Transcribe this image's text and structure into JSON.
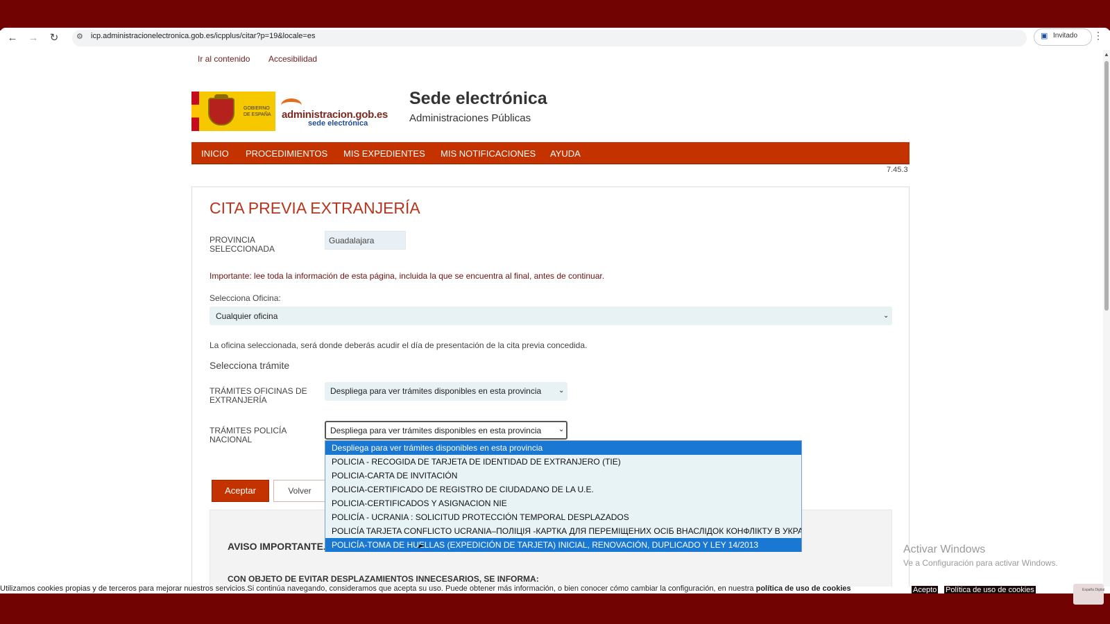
{
  "browser": {
    "url": "icp.administracionelectronica.gob.es/icpplus/citar?p=19&locale=es",
    "profile_label": "Invitado"
  },
  "skip_links": {
    "content": "Ir al contenido",
    "accessibility": "Accesibilidad"
  },
  "header": {
    "gobierno_text": "GOBIERNO\nDE ESPAÑA",
    "logo_text": "administracion.gob.es",
    "logo_subtext": "sede electrónica",
    "title": "Sede electrónica",
    "subtitle": "Administraciones Públicas"
  },
  "nav": {
    "items": [
      "INICIO",
      "PROCEDIMIENTOS",
      "MIS EXPEDIENTES",
      "MIS NOTIFICACIONES",
      "AYUDA"
    ],
    "version": "7.45.3"
  },
  "form": {
    "title": "CITA PREVIA EXTRANJERÍA",
    "province_label_1": "PROVINCIA",
    "province_label_2": "SELECCIONADA",
    "province_value": "Guadalajara",
    "important": "Importante: lee toda la información de esta página, incluida la que se encuentra al final, antes de continuar.",
    "office_label": "Selecciona Oficina:",
    "office_value": "Cualquier oficina",
    "office_note": "La oficina seleccionada, será donde deberás acudir el día de presentación de la cita previa concedida.",
    "tramite_heading": "Selecciona trámite",
    "extranjeria_label_1": "TRÁMITES OFICINAS DE",
    "extranjeria_label_2": "EXTRANJERÍA",
    "extranjeria_value": "Despliega para ver trámites disponibles en esta provincia",
    "policia_label_1": "TRÁMITES POLICÍA",
    "policia_label_2": "NACIONAL",
    "policia_value": "Despliega para ver trámites disponibles en esta provincia",
    "accept_label": "Aceptar",
    "back_label": "Volver"
  },
  "dropdown": {
    "options": [
      "Despliega para ver trámites disponibles en esta provincia",
      "POLICIA - RECOGIDA DE TARJETA DE IDENTIDAD DE EXTRANJERO (TIE)",
      "POLICIA-CARTA DE INVITACIÓN",
      "POLICIA-CERTIFICADO DE REGISTRO DE CIUDADANO DE LA U.E.",
      "POLICIA-CERTIFICADOS Y ASIGNACION NIE",
      "POLICÍA - UCRANIA : SOLICITUD PROTECCIÓN TEMPORAL DESPLAZADOS",
      "POLICÍA TARJETA CONFLICTO UCRANIA–ПОЛІЦІЯ -КАРТКА ДЛЯ ПЕРЕМІЩЕНИХ ОСІБ ВНАСЛІДОК КОНФЛІКТУ В УКРАЇНІ",
      "POLICÍA-TOMA DE HUELLAS (EXPEDICIÓN DE TARJETA) INICIAL, RENOVACIÓN, DUPLICADO Y LEY 14/2013"
    ]
  },
  "notice": {
    "title": "AVISO IMPORTANTE.",
    "text": "CON OBJETO DE EVITAR DESPLAZAMIENTOS INNECESARIOS, SE INFORMA:"
  },
  "windows": {
    "line1": "Activar Windows",
    "line2": "Ve a Configuración para activar Windows."
  },
  "cookies": {
    "text": "Utilizamos cookies propias y de terceros para mejorar nuestros servicios.Si continúa navegando, consideramos que acepta su uso. Puede obtener más información, o bien conocer cómo cambiar la configuración, en nuestra ",
    "link": "política de uso de cookies",
    "accept": "Acepto",
    "policy": "Política de uso de cookies"
  },
  "tray": {
    "text": "España Digital"
  },
  "colors": {
    "band": "#720303",
    "nav": "#c43200",
    "title": "#b5351e",
    "selected_option": "#1a78d2"
  }
}
